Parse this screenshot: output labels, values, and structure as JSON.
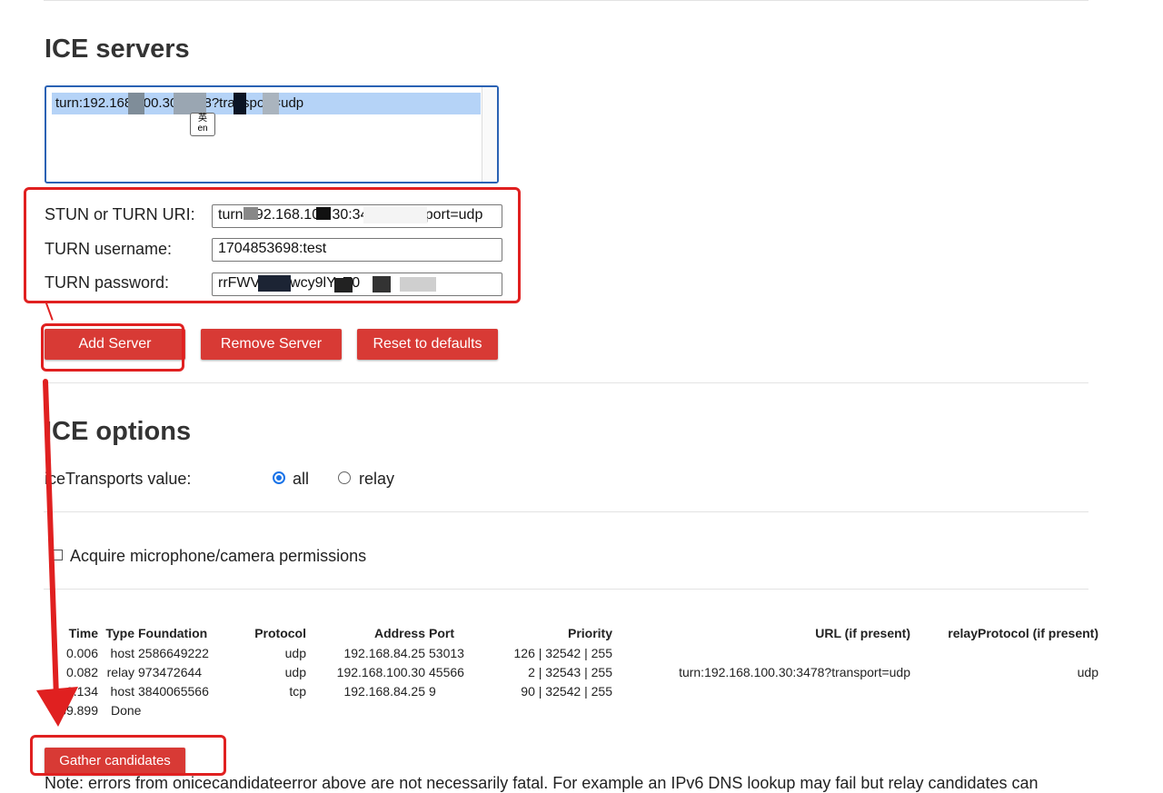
{
  "ice_servers": {
    "title": "ICE servers",
    "list_entry": "turn:192.168.100.30:3478?transport=udp",
    "ime_badge": {
      "top": "英",
      "bottom": "en"
    }
  },
  "server_form": {
    "uri_label": "STUN or TURN URI:",
    "uri_value": "turn:192.168.100.30:3478?transport=udp",
    "username_label": "TURN username:",
    "username_value": "1704853698:test",
    "password_label": "TURN password:",
    "password_value": "rrFWV35Wwcy9lYaT0"
  },
  "buttons": {
    "add_server": "Add Server",
    "remove_server": "Remove Server",
    "reset_defaults": "Reset to defaults",
    "gather": "Gather candidates"
  },
  "ice_options": {
    "title": "ICE options",
    "transports_label": "iceTransports value:",
    "options": [
      "all",
      "relay"
    ],
    "selected": "all",
    "permissions_label": "Acquire microphone/camera permissions"
  },
  "candidates": {
    "headers": [
      "Time",
      "Type",
      "Foundation",
      "Protocol",
      "Address",
      "Port",
      "Priority",
      "URL (if present)",
      "relayProtocol (if present)"
    ],
    "rows": [
      [
        "0.006",
        "host",
        "2586649222",
        "udp",
        "192.168.84.25",
        "53013",
        "126 | 32542 | 255",
        "",
        ""
      ],
      [
        "0.082",
        "relay",
        "973472644",
        "udp",
        "192.168.100.30",
        "45566",
        "2 | 32543 | 255",
        "turn:192.168.100.30:3478?transport=udp",
        "udp"
      ],
      [
        "0.134",
        "host",
        "3840065566",
        "tcp",
        "192.168.84.25",
        "9",
        "90 | 32542 | 255",
        "",
        ""
      ]
    ],
    "done_time": "39.899",
    "done_label": "Done"
  },
  "note": "Note: errors from onicecandidateerror above are not necessarily fatal. For example an IPv6 DNS lookup may fail but relay candidates can",
  "colors": {
    "button": "#d83a35",
    "annotation": "#e02020",
    "focus": "#2a62b4",
    "selection": "#b5d3f7"
  }
}
